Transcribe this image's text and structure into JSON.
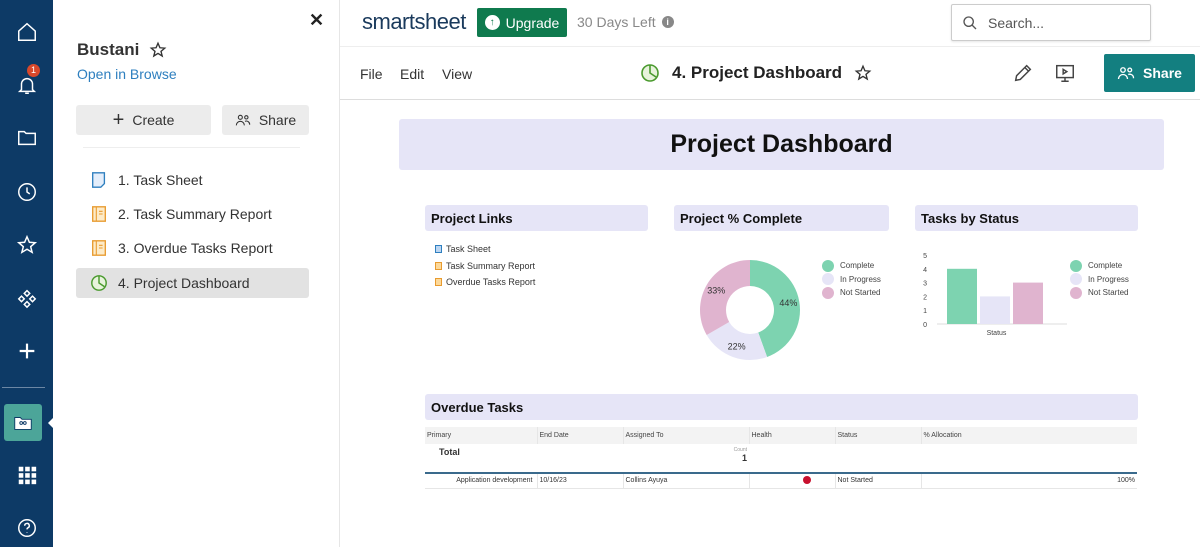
{
  "rail": {
    "notification_count": "1"
  },
  "panel": {
    "workspace_name": "Bustani",
    "open_in_browse": "Open in Browse",
    "create_label": "Create",
    "share_label": "Share",
    "items": [
      {
        "label": "1. Task Sheet",
        "icon": "sheet-icon"
      },
      {
        "label": "2. Task Summary Report",
        "icon": "report-icon"
      },
      {
        "label": "3. Overdue Tasks Report",
        "icon": "report-icon"
      },
      {
        "label": "4. Project Dashboard",
        "icon": "dashboard-icon",
        "selected": true
      }
    ]
  },
  "topbar": {
    "logo": "smartsheet",
    "upgrade_label": "Upgrade",
    "trial_text": "30 Days Left",
    "search_placeholder": "Search..."
  },
  "toolbar": {
    "menus": [
      "File",
      "Edit",
      "View"
    ],
    "sheet_title": "4. Project Dashboard",
    "share_label": "Share"
  },
  "dashboard": {
    "title": "Project Dashboard",
    "links_widget": {
      "title": "Project Links",
      "links": [
        "Task Sheet",
        "Task Summary Report",
        "Overdue Tasks Report"
      ]
    },
    "overdue_widget": {
      "title": "Overdue Tasks",
      "columns": [
        "Primary",
        "End Date",
        "Assigned To",
        "Health",
        "Status",
        "% Allocation"
      ],
      "total_label": "Total",
      "count_label": "Count",
      "count_value": "1",
      "rows": [
        {
          "primary": "Application development",
          "end_date": "10/16/23",
          "assigned_to": "Collins Ayuya",
          "health": "red",
          "status": "Not Started",
          "allocation": "100%"
        }
      ]
    }
  },
  "colors": {
    "complete": "#7dd3b0",
    "in_progress": "#e6e5f7",
    "not_started": "#e0b4cf",
    "health_red": "#c8102e"
  },
  "chart_data": [
    {
      "type": "pie",
      "title": "Project % Complete",
      "categories": [
        "Complete",
        "In Progress",
        "Not Started"
      ],
      "values": [
        44,
        22,
        33
      ],
      "labels": [
        "44%",
        "22%",
        "33%"
      ],
      "legend": "right"
    },
    {
      "type": "bar",
      "title": "Tasks by Status",
      "xlabel": "Status",
      "categories": [
        "Status"
      ],
      "series": [
        {
          "name": "Complete",
          "values": [
            4
          ]
        },
        {
          "name": "In Progress",
          "values": [
            2
          ]
        },
        {
          "name": "Not Started",
          "values": [
            3
          ]
        }
      ],
      "yticks": [
        "0",
        "1",
        "2",
        "3",
        "4",
        "5"
      ],
      "ylim": [
        0,
        5
      ],
      "legend": "right"
    }
  ]
}
